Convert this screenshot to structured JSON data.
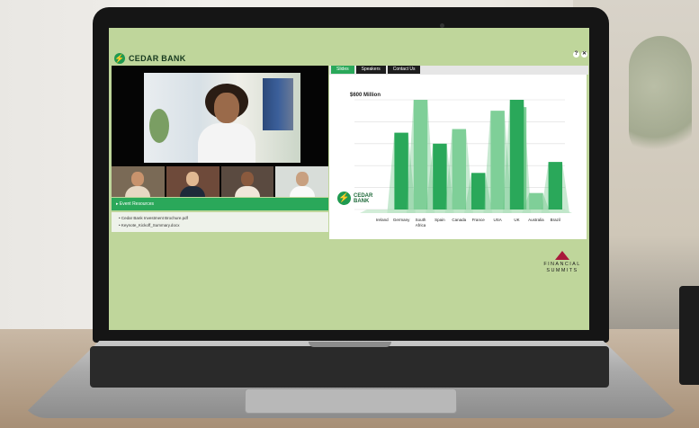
{
  "brand": {
    "name": "CEDAR BANK",
    "mark": "⚡"
  },
  "top_icons": {
    "help": "?",
    "close": "✕"
  },
  "tabs": [
    {
      "label": "Slides",
      "active": true
    },
    {
      "label": "Speakers",
      "active": false
    },
    {
      "label": "Contact Us",
      "active": false
    }
  ],
  "resources": {
    "title": "▸ Event Resources",
    "items": [
      "• Cedar Bank Investment Brochure.pdf",
      "• Keynote_Kickoff_Summary.docx"
    ]
  },
  "slide_logo": {
    "line1": "CEDAR",
    "line2": "BANK",
    "mark": "⚡"
  },
  "footer_logo": {
    "line1": "FINANCIAL",
    "line2": "SUMMITS"
  },
  "chart_data": {
    "type": "bar",
    "title": "$600 Million",
    "categories": [
      "Ireland",
      "Germany",
      "South Africa",
      "Spain",
      "Canada",
      "France",
      "USA",
      "UK",
      "Australia",
      "Brazil"
    ],
    "values": [
      0,
      420,
      600,
      360,
      440,
      200,
      540,
      600,
      90,
      260
    ],
    "back_values": [
      0,
      0,
      0,
      0,
      0,
      0,
      0,
      560,
      0,
      0
    ],
    "ylim": [
      0,
      600
    ],
    "colors": {
      "front": "#2aa85a",
      "back": "#7fcf98",
      "top": "#5fbf7a"
    }
  },
  "colors": {
    "accent": "#2aa85a",
    "screen_bg": "#bfd69b"
  }
}
